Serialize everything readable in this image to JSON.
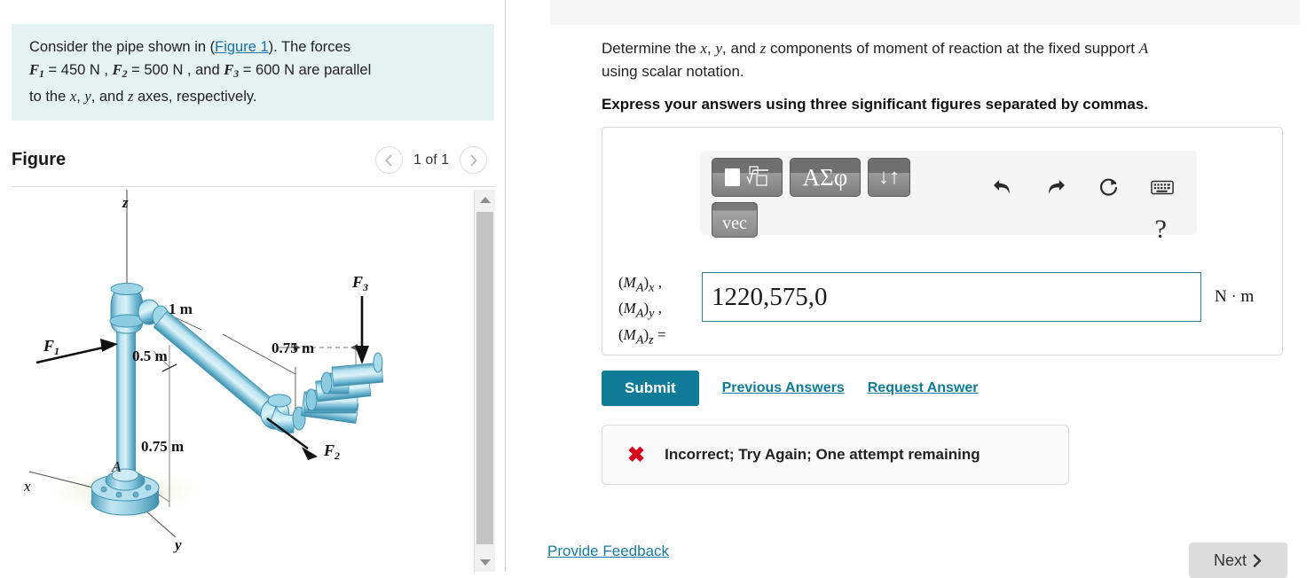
{
  "problem": {
    "text_before_link": "Consider the pipe shown in (",
    "figure_link": "Figure 1",
    "text_after_link": "). The forces",
    "line2_f1": "F",
    "line2": "= 450 N , ",
    "f1_val": "450 N",
    "f2_val": "500 N",
    "f3_val": "600 N",
    "line3": "to the x, y, and z axes, respectively.",
    "full_line2": "F₁ = 450 N , F₂ = 500 N , and F₃ = 600 N are parallel"
  },
  "figure": {
    "title": "Figure",
    "pager_label": "1 of 1",
    "prev_icon": "chevron-left-icon",
    "next_icon": "chevron-right-icon",
    "labels": {
      "axis_x": "x",
      "axis_y": "y",
      "axis_z": "z",
      "point_a": "A",
      "force1": "F",
      "force1_sub": "1",
      "force2": "F",
      "force2_sub": "2",
      "force3": "F",
      "force3_sub": "3",
      "dim_1m": "1 m",
      "dim_05m": "0.5 m",
      "dim_075m_top": "0.75 m",
      "dim_075m_bottom": "0.75 m"
    },
    "pipe_color": "#7ec4da",
    "pipe_dark": "#3f93b3"
  },
  "question": {
    "prompt_part1": "Determine the ",
    "prompt_x": "x",
    "prompt_y": "y",
    "prompt_z": "z",
    "prompt_part2": " components of moment of reaction at the fixed support ",
    "prompt_a": "A",
    "prompt_part3": " using scalar notation.",
    "bold_instruction": "Express your answers using three significant figures separated by commas."
  },
  "toolbar": {
    "sqrt_button": "template-button",
    "greek_button": "ΑΣφ",
    "updown_button": "↓↑",
    "vec_button": "vec",
    "undo_icon": "undo-icon",
    "redo_icon": "redo-icon",
    "reset_icon": "reset-icon",
    "keyboard_icon": "keyboard-icon",
    "help_label": "?"
  },
  "answer": {
    "label_x": "(M",
    "label_sub_a": "A",
    "label_x_end": ")x ,",
    "label_y_end": ")y ,",
    "label_z_end": ")z =",
    "value": "1220,575,0",
    "units": "N · m"
  },
  "actions": {
    "submit_label": "Submit",
    "previous_answers_label": "Previous Answers",
    "request_answer_label": "Request Answer"
  },
  "feedback": {
    "icon": "x-mark-icon",
    "message": "Incorrect; Try Again; One attempt remaining",
    "color": "#d6001c"
  },
  "footer": {
    "provide_feedback_label": "Provide Feedback",
    "next_label": "Next",
    "next_icon": "chevron-right-icon"
  },
  "colors": {
    "accent": "#0f7b96",
    "statement_bg": "#e4f2f2",
    "link": "#1a7ba5"
  }
}
